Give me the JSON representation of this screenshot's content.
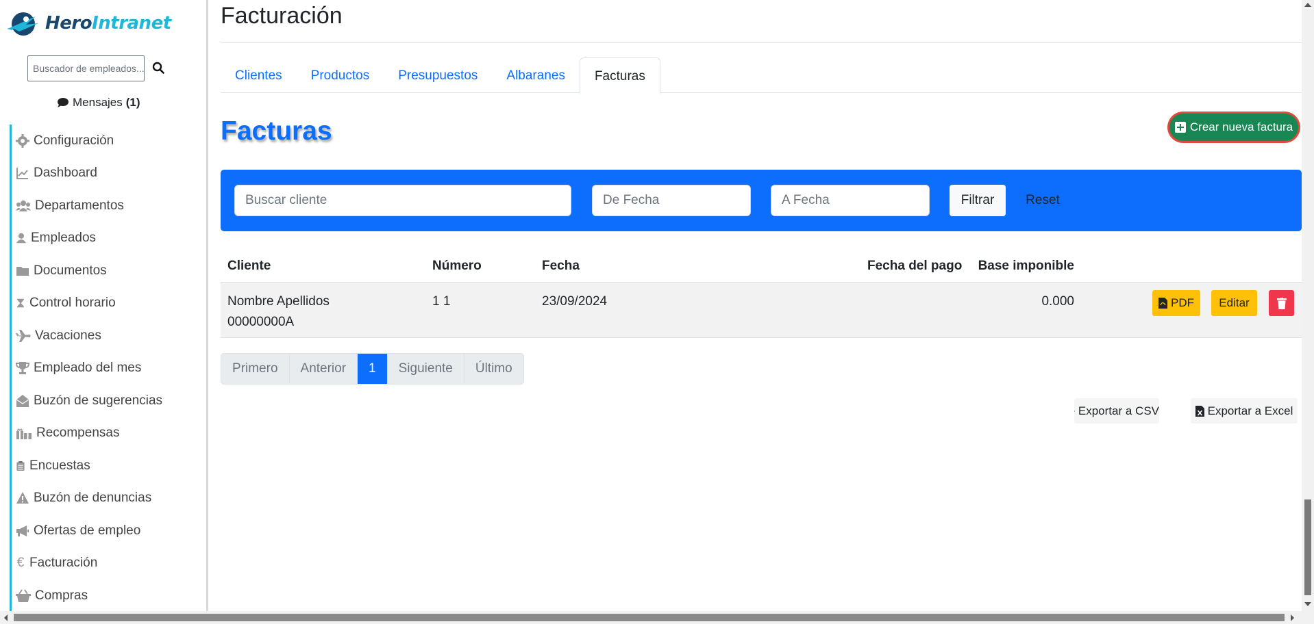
{
  "brand": {
    "part1": "Hero",
    "part2": "Intranet"
  },
  "sidebar": {
    "search_placeholder": "Buscador de empleados...",
    "messages_label": "Mensajes",
    "messages_count": "(1)",
    "items": [
      {
        "label": "Configuración",
        "icon": "gear-icon"
      },
      {
        "label": "Dashboard",
        "icon": "chart-line-icon"
      },
      {
        "label": "Departamentos",
        "icon": "users-icon"
      },
      {
        "label": "Empleados",
        "icon": "user-icon"
      },
      {
        "label": "Documentos",
        "icon": "folder-icon"
      },
      {
        "label": "Control horario",
        "icon": "hourglass-icon"
      },
      {
        "label": "Vacaciones",
        "icon": "plane-icon"
      },
      {
        "label": "Empleado del mes",
        "icon": "trophy-icon"
      },
      {
        "label": "Buzón de sugerencias",
        "icon": "envelope-open-icon"
      },
      {
        "label": "Recompensas",
        "icon": "gifts-icon"
      },
      {
        "label": "Encuestas",
        "icon": "clipboard-list-icon"
      },
      {
        "label": "Buzón de denuncias",
        "icon": "warning-icon"
      },
      {
        "label": "Ofertas de empleo",
        "icon": "megaphone-icon"
      },
      {
        "label": "Facturación",
        "icon": "euro-icon"
      },
      {
        "label": "Compras",
        "icon": "basket-icon"
      }
    ]
  },
  "main": {
    "page_title": "Facturación",
    "tabs": [
      {
        "label": "Clientes",
        "active": false
      },
      {
        "label": "Productos",
        "active": false
      },
      {
        "label": "Presupuestos",
        "active": false
      },
      {
        "label": "Albaranes",
        "active": false
      },
      {
        "label": "Facturas",
        "active": true
      }
    ],
    "section_title": "Facturas",
    "create_button": "Crear nueva factura",
    "filters": {
      "client_placeholder": "Buscar cliente",
      "from_placeholder": "De Fecha",
      "to_placeholder": "A Fecha",
      "filter_button": "Filtrar",
      "reset_button": "Reset"
    },
    "table": {
      "headers": [
        "Cliente",
        "Número",
        "Fecha",
        "Base imponible",
        "Fecha del pago"
      ],
      "rows": [
        {
          "client_name": "Nombre Apellidos",
          "client_id": "00000000A",
          "number": "1 1",
          "date": "23/09/2024",
          "base": "0.000",
          "payment_date": "",
          "pdf_label": "PDF",
          "edit_label": "Editar"
        }
      ]
    },
    "pagination": [
      "Primero",
      "Anterior",
      "1",
      "Siguiente",
      "Último"
    ],
    "pagination_active": "1",
    "export_csv": "Exportar a CSV",
    "export_excel": "Exportar a Excel"
  },
  "colors": {
    "primary": "#0d6efd",
    "success": "#198754",
    "warning": "#ffc107",
    "danger": "#f0364a",
    "brand_dark": "#17476e",
    "brand_light": "#1fb6d9"
  }
}
